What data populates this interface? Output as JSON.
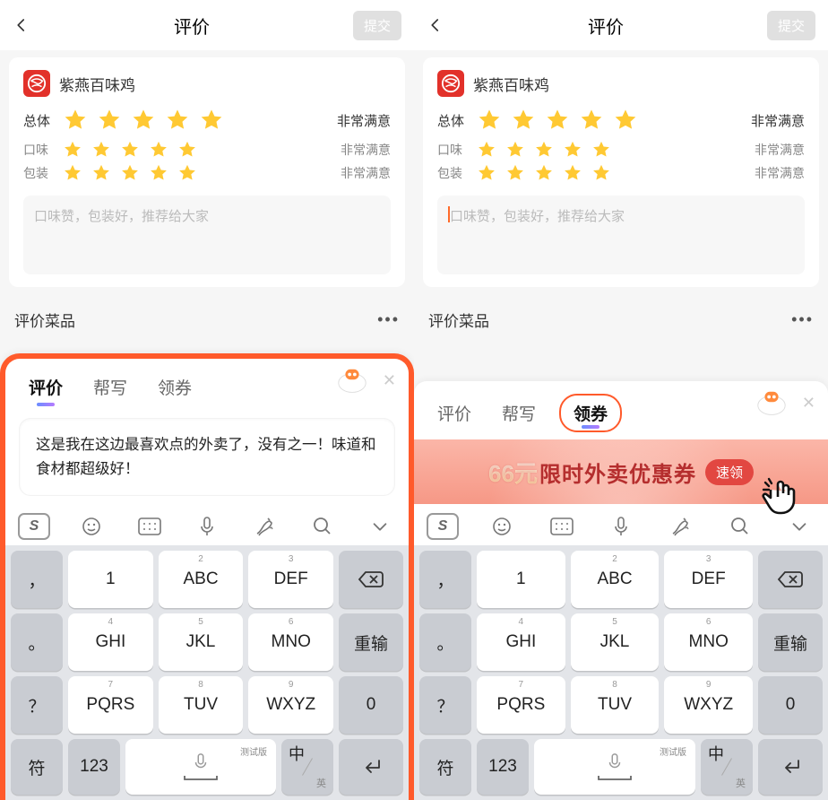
{
  "nav": {
    "title": "评价",
    "submit": "提交"
  },
  "shop": {
    "name": "紫燕百味鸡"
  },
  "ratings": {
    "overall": {
      "label": "总体",
      "text": "非常满意"
    },
    "taste": {
      "label": "口味",
      "text": "非常满意"
    },
    "pack": {
      "label": "包装",
      "text": "非常满意"
    }
  },
  "comment_placeholder": "口味赞，包装好，推荐给大家",
  "eval_menu": "评价菜品",
  "sheet_tabs": {
    "review": "评价",
    "help": "帮写",
    "coupon": "领券"
  },
  "suggestion_text": "这是我在这边最喜欢点的外卖了，没有之一！味道和食材都超级好！",
  "coupon": {
    "amount": "66元",
    "rest": "限时外卖优惠券",
    "btn": "速领"
  },
  "keys": {
    "punct1": "，",
    "punct2": "。",
    "punct3": "？",
    "punct4": "！",
    "k1": "1",
    "k2_s": "2",
    "k2": "ABC",
    "k3_s": "3",
    "k3": "DEF",
    "k4_s": "4",
    "k4": "GHI",
    "k5_s": "5",
    "k5": "JKL",
    "k6_s": "6",
    "k6": "MNO",
    "k7_s": "7",
    "k7": "PQRS",
    "k8_s": "8",
    "k8": "TUV",
    "k9_s": "9",
    "k9": "WXYZ",
    "retype": "重输",
    "zero": "0",
    "sym": "符",
    "num": "123",
    "mic_label": "测试版",
    "zhong": "中",
    "ying": "英"
  }
}
